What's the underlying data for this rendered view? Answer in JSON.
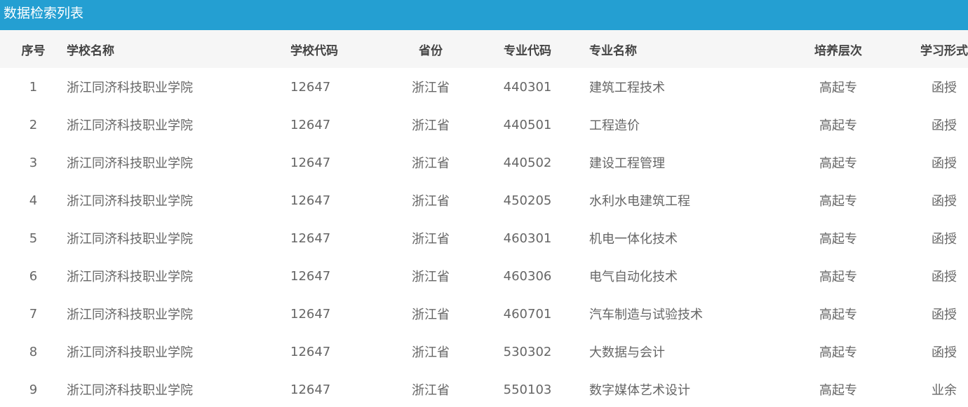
{
  "panel": {
    "title": "数据检索列表"
  },
  "table": {
    "headers": {
      "index": "序号",
      "school_name": "学校名称",
      "school_code": "学校代码",
      "province": "省份",
      "major_code": "专业代码",
      "major_name": "专业名称",
      "level": "培养层次",
      "study_mode": "学习形式"
    },
    "rows": [
      {
        "index": "1",
        "school_name": "浙江同济科技职业学院",
        "school_code": "12647",
        "province": "浙江省",
        "major_code": "440301",
        "major_name": "建筑工程技术",
        "level": "高起专",
        "study_mode": "函授"
      },
      {
        "index": "2",
        "school_name": "浙江同济科技职业学院",
        "school_code": "12647",
        "province": "浙江省",
        "major_code": "440501",
        "major_name": "工程造价",
        "level": "高起专",
        "study_mode": "函授"
      },
      {
        "index": "3",
        "school_name": "浙江同济科技职业学院",
        "school_code": "12647",
        "province": "浙江省",
        "major_code": "440502",
        "major_name": "建设工程管理",
        "level": "高起专",
        "study_mode": "函授"
      },
      {
        "index": "4",
        "school_name": "浙江同济科技职业学院",
        "school_code": "12647",
        "province": "浙江省",
        "major_code": "450205",
        "major_name": "水利水电建筑工程",
        "level": "高起专",
        "study_mode": "函授"
      },
      {
        "index": "5",
        "school_name": "浙江同济科技职业学院",
        "school_code": "12647",
        "province": "浙江省",
        "major_code": "460301",
        "major_name": "机电一体化技术",
        "level": "高起专",
        "study_mode": "函授"
      },
      {
        "index": "6",
        "school_name": "浙江同济科技职业学院",
        "school_code": "12647",
        "province": "浙江省",
        "major_code": "460306",
        "major_name": "电气自动化技术",
        "level": "高起专",
        "study_mode": "函授"
      },
      {
        "index": "7",
        "school_name": "浙江同济科技职业学院",
        "school_code": "12647",
        "province": "浙江省",
        "major_code": "460701",
        "major_name": "汽车制造与试验技术",
        "level": "高起专",
        "study_mode": "函授"
      },
      {
        "index": "8",
        "school_name": "浙江同济科技职业学院",
        "school_code": "12647",
        "province": "浙江省",
        "major_code": "530302",
        "major_name": "大数据与会计",
        "level": "高起专",
        "study_mode": "函授"
      },
      {
        "index": "9",
        "school_name": "浙江同济科技职业学院",
        "school_code": "12647",
        "province": "浙江省",
        "major_code": "550103",
        "major_name": "数字媒体艺术设计",
        "level": "高起专",
        "study_mode": "业余"
      }
    ]
  },
  "colors": {
    "title_bar": "#249fd2",
    "header_row": "#f6f6f6",
    "header_text": "#444444",
    "cell_text": "#666666"
  }
}
